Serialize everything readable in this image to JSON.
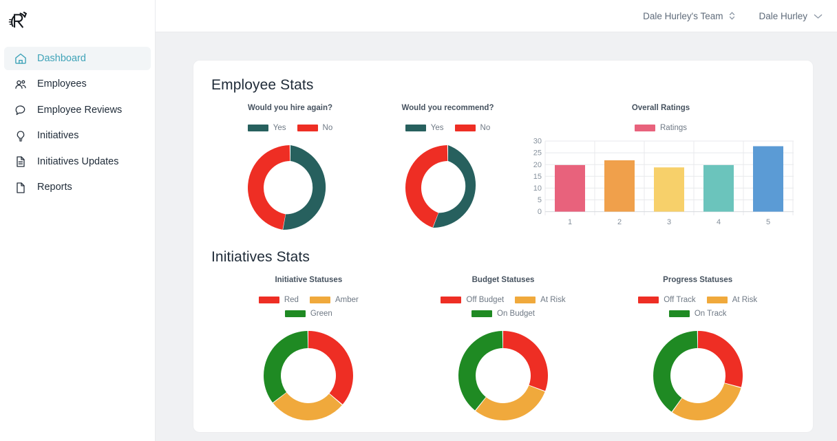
{
  "brand": {
    "logo_alt": "R logo"
  },
  "topbar": {
    "team_selector": "Dale Hurley's Team",
    "user_menu": "Dale Hurley"
  },
  "sidebar": {
    "items": [
      {
        "label": "Dashboard",
        "icon": "home-icon",
        "active": true
      },
      {
        "label": "Employees",
        "icon": "people-icon",
        "active": false
      },
      {
        "label": "Employee Reviews",
        "icon": "chat-bubble-icon",
        "active": false
      },
      {
        "label": "Initiatives",
        "icon": "lightbulb-icon",
        "active": false
      },
      {
        "label": "Initiatives Updates",
        "icon": "document-lines-icon",
        "active": false
      },
      {
        "label": "Reports",
        "icon": "document-icon",
        "active": false
      }
    ]
  },
  "colors": {
    "accent": "#3fa3b8",
    "teal": "#27605e",
    "red": "#ee2e24",
    "amber": "#f0a93c",
    "green": "#1f8a23",
    "ratings_pink": "#e8627c",
    "background": "#f0f1f3"
  },
  "sections": [
    {
      "title": "Employee Stats"
    },
    {
      "title": "Initiatives Stats"
    }
  ],
  "chart_data": [
    {
      "type": "pie",
      "title": "Would you hire again?",
      "legend_position": "top",
      "labels": [
        "Yes",
        "No"
      ],
      "values": [
        53,
        47
      ],
      "colors": [
        "#27605e",
        "#ee2e24"
      ]
    },
    {
      "type": "pie",
      "title": "Would you recommend?",
      "legend_position": "top",
      "labels": [
        "Yes",
        "No"
      ],
      "values": [
        56,
        44
      ],
      "colors": [
        "#27605e",
        "#ee2e24"
      ]
    },
    {
      "type": "bar",
      "title": "Overall Ratings",
      "legend_position": "top",
      "legend": [
        "Ratings"
      ],
      "categories": [
        "1",
        "2",
        "3",
        "4",
        "5"
      ],
      "values": [
        19.8,
        21.8,
        18.8,
        19.8,
        27.8
      ],
      "xlabel": "",
      "ylabel": "",
      "ylim": [
        0,
        30
      ],
      "yticks": [
        0,
        5,
        10,
        15,
        20,
        25,
        30
      ],
      "grid": true,
      "colors": [
        "#e8627c",
        "#f0a04b",
        "#f7d06a",
        "#6bc4bc",
        "#5b9bd5"
      ]
    },
    {
      "type": "pie",
      "title": "Initiative Statuses",
      "legend_position": "top",
      "labels": [
        "Red",
        "Amber",
        "Green"
      ],
      "values": [
        36,
        28,
        36
      ],
      "colors": [
        "#ee2e24",
        "#f0a93c",
        "#1f8a23"
      ]
    },
    {
      "type": "pie",
      "title": "Budget Statuses",
      "legend_position": "top",
      "labels": [
        "Off Budget",
        "At Risk",
        "On Budget"
      ],
      "values": [
        30,
        30,
        40
      ],
      "colors": [
        "#ee2e24",
        "#f0a93c",
        "#1f8a23"
      ]
    },
    {
      "type": "pie",
      "title": "Progress Statuses",
      "legend_position": "top",
      "labels": [
        "Off Track",
        "At Risk",
        "On Track"
      ],
      "values": [
        29,
        31,
        40
      ],
      "colors": [
        "#ee2e24",
        "#f0a93c",
        "#1f8a23"
      ]
    }
  ]
}
